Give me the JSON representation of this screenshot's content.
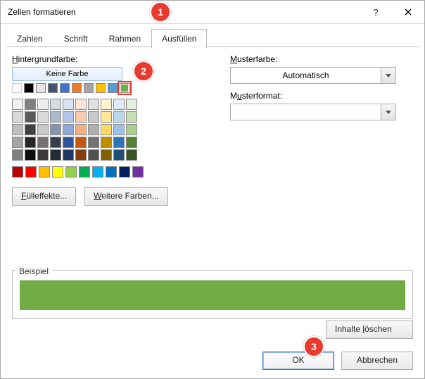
{
  "title": "Zellen formatieren",
  "tabs": [
    "Zahlen",
    "Schrift",
    "Rahmen",
    "Ausfüllen"
  ],
  "active_tab": 3,
  "left": {
    "bg_label": "Hintergrundfarbe:",
    "no_color": "Keine Farbe",
    "theme_row": [
      "#ffffff",
      "#000000",
      "#e7e6e6",
      "#44546a",
      "#4472c4",
      "#ed7d31",
      "#a5a5a5",
      "#ffc000",
      "#5b9bd5",
      "#70ad47"
    ],
    "tint_grid": [
      [
        "#f2f2f2",
        "#808080",
        "#ededed",
        "#d6dce4",
        "#d9e1f2",
        "#fce4d6",
        "#e2e2e2",
        "#fff2cc",
        "#ddebf7",
        "#e2efda"
      ],
      [
        "#d9d9d9",
        "#595959",
        "#dbdbdb",
        "#acb9ca",
        "#b4c6e7",
        "#f8cbad",
        "#c9c9c9",
        "#ffe699",
        "#bdd7ee",
        "#c6e0b4"
      ],
      [
        "#bfbfbf",
        "#404040",
        "#c9c9c9",
        "#8497b0",
        "#8ea9db",
        "#f4b084",
        "#b0b0b0",
        "#ffd966",
        "#9bc2e6",
        "#a9d08e"
      ],
      [
        "#a6a6a6",
        "#262626",
        "#767171",
        "#333f4f",
        "#305496",
        "#c65911",
        "#757171",
        "#bf8f00",
        "#2f75b5",
        "#548235"
      ],
      [
        "#808080",
        "#0d0d0d",
        "#3a3838",
        "#222b35",
        "#203764",
        "#833c0c",
        "#525252",
        "#806000",
        "#1f4e78",
        "#375623"
      ]
    ],
    "std_row": [
      "#c00000",
      "#ff0000",
      "#ffc000",
      "#ffff00",
      "#92d050",
      "#00b050",
      "#00b0f0",
      "#0070c0",
      "#002060",
      "#7030a0"
    ],
    "selected_color": "#70ad47",
    "fill_effects_btn": "Fülleffekte...",
    "more_colors_btn": "Weitere Farben..."
  },
  "right": {
    "pattern_color_label": "Musterfarbe:",
    "pattern_color_value": "Automatisch",
    "pattern_style_label": "Musterformat:",
    "pattern_style_value": ""
  },
  "example_label": "Beispiel",
  "example_fill": "#70ad47",
  "clear_btn": "Inhalte löschen",
  "ok_btn": "OK",
  "cancel_btn": "Abbrechen",
  "callouts": {
    "one": "1",
    "two": "2",
    "three": "3"
  }
}
